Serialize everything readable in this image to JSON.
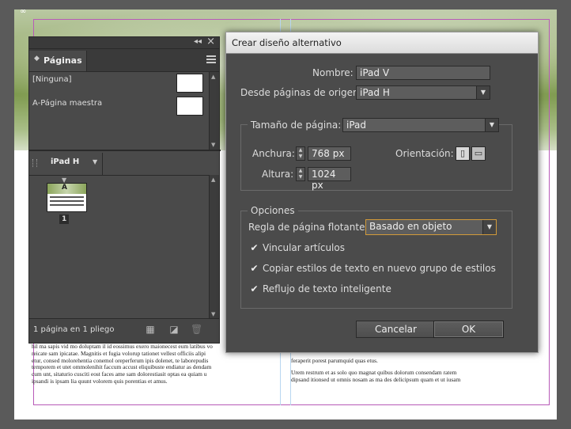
{
  "panel": {
    "tab_label": "Páginas",
    "masters": [
      {
        "label": "[Ninguna]"
      },
      {
        "label": "A-Página maestra"
      }
    ],
    "page_size_label": "iPad H",
    "page_number": "1",
    "thumb_letter": "A",
    "status": "1 página en 1 pliego"
  },
  "dialog": {
    "title": "Crear diseño alternativo",
    "nombre_label": "Nombre:",
    "nombre_value": "iPad V",
    "desde_label": "Desde páginas de origen",
    "desde_value": "iPad H",
    "tamano_label": "Tamaño de página:",
    "tamano_value": "iPad",
    "anchura_label": "Anchura:",
    "anchura_value": "768 px",
    "altura_label": "Altura:",
    "altura_value": "1024 px",
    "orientacion_label": "Orientación:",
    "opciones_label": "Opciones",
    "regla_label": "Regla de página flotante:",
    "regla_value": "Basado en objeto",
    "checkboxes": [
      {
        "label": "Vincular artículos",
        "checked": true
      },
      {
        "label": "Copiar estilos de texto en nuevo grupo de estilos",
        "checked": true
      },
      {
        "label": "Reflujo de texto inteligente",
        "checked": true
      }
    ],
    "cancel_label": "Cancelar",
    "ok_label": "OK"
  },
  "document": {
    "left_lines": [
      "hil ma sapis vid mo doluptam il id eossimus exero maionecest eum latibus vo",
      "reicate sam ipicatae. Magnitis et fugia volorup tationet vellest officiis alipi",
      "etur, consed molorehentia conemol oreperferum ipis dolenet, te laborepudis",
      "temporem et utet ommolenihit faccum accust eliquibuste endiatur as dendam",
      "cum unt, sitaturio cusciti eost faces ame sam dolorestiasit optas ea quiam u",
      "ipsandi is ipsam lia quunt volorem quis porentias et amus."
    ],
    "right_lines": [
      "feraperit porest parumquid quas etus.",
      "",
      "Urem restrum et as solo quo magnat quibus dolorum consendam ratem",
      "dipsand itionsed ut omnis nosam as ma des delicipsum quam et ut iusam"
    ]
  }
}
